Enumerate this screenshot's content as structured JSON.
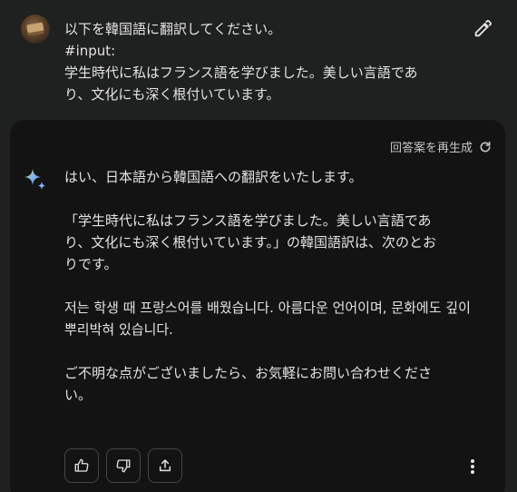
{
  "prompt": {
    "lines": [
      "以下を韓国語に翻訳してください。",
      "#input:",
      "学生時代に私はフランス語を学びました。美しい言語であ",
      "り、文化にも深く根付いています。"
    ]
  },
  "response": {
    "regenerate_label": "回答案を再生成",
    "paragraphs": [
      "はい、日本語から韓国語への翻訳をいたします。",
      "「学生時代に私はフランス語を学びました。美しい言語であ\nり、文化にも深く根付いています。」の韓国語訳は、次のとお\nりです。",
      "저는 학생 때 프랑스어를 배웠습니다. 아름다운 언어이며, 문화에도 깊이\n뿌리박혀 있습니다.",
      "ご不明な点がございましたら、お気軽にお問い合わせくださ\nい。"
    ]
  },
  "icons": {
    "edit": "pencil-icon",
    "regenerate": "refresh-icon",
    "assistant": "sparkle-icon",
    "like": "thumbs-up-icon",
    "dislike": "thumbs-down-icon",
    "share": "share-icon",
    "more": "more-vertical-icon"
  },
  "colors": {
    "page_bg": "#1f2020",
    "card_bg": "#131314",
    "text": "#e3e3e3",
    "muted": "#c4c7c5",
    "accent_blue": "#8ab4f8"
  }
}
